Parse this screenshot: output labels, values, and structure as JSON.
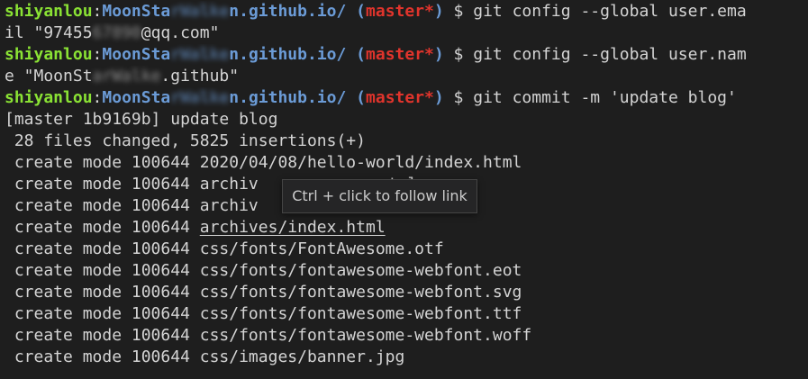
{
  "colors": {
    "background": "#1e1e1e",
    "text": "#d4d4d4",
    "user": "#8ae234",
    "path": "#6b9bd6",
    "branch": "#e0342c"
  },
  "prompt": {
    "user": "shiyanlou",
    "sep": ":",
    "path_a": "MoonSta",
    "path_b": "n.github.io/",
    "open_paren": " (",
    "branch": "master*",
    "close_paren": ")",
    "dollar": " $ "
  },
  "commands": {
    "cmd1_a": "git config --global user.ema",
    "cmd1_b": "il \"97455",
    "cmd1_c": "@qq.com\"",
    "cmd2_a": "git config --global user.nam",
    "cmd2_b": "e \"MoonSt",
    "cmd2_c": ".github\"",
    "cmd3": "git commit -m 'update blog'"
  },
  "output": {
    "commit_line": "[master 1b9169b] update blog",
    "summary": " 28 files changed, 5825 insertions(+)",
    "create_prefix": " create mode 100644 ",
    "files": [
      "2020/04/08/hello-world/index.html",
      "archives/2020/04/index.html",
      "archives/2020/index.html",
      "archives/index.html",
      "css/fonts/FontAwesome.otf",
      "css/fonts/fontawesome-webfont.eot",
      "css/fonts/fontawesome-webfont.svg",
      "css/fonts/fontawesome-webfont.ttf",
      "css/fonts/fontawesome-webfont.woff",
      "css/images/banner.jpg"
    ],
    "partial_file_1_a": "archiv",
    "partial_file_1_b": "tml",
    "partial_file_2": "archiv"
  },
  "tooltip": {
    "text": "Ctrl + click to follow link"
  }
}
